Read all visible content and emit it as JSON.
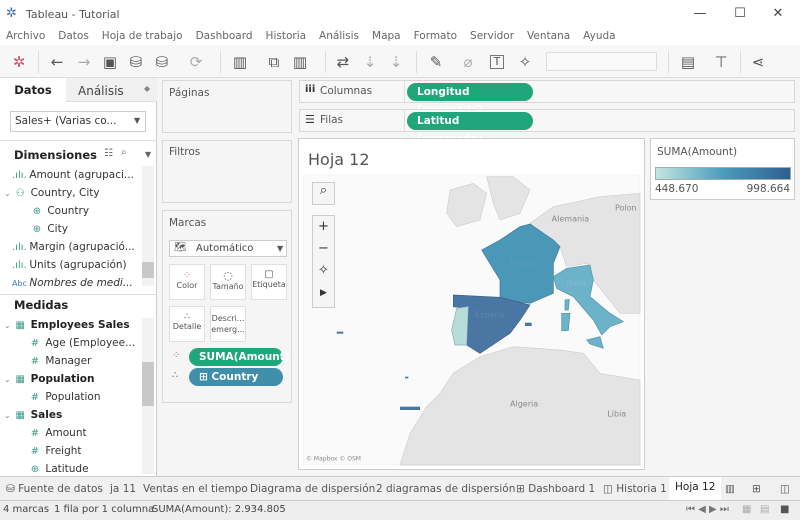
{
  "window": {
    "title": "Tableau - Tutorial",
    "minimize": "—",
    "maximize": "☐",
    "close": "✕"
  },
  "menu": [
    "Archivo",
    "Datos",
    "Hoja de trabajo",
    "Dashboard",
    "Historia",
    "Análisis",
    "Mapa",
    "Formato",
    "Servidor",
    "Ventana",
    "Ayuda"
  ],
  "left": {
    "tab_data": "Datos",
    "tab_analysis": "Análisis",
    "datasource": "Sales+ (Varias co...",
    "dimensions_label": "Dimensiones",
    "dimensions": [
      {
        "icon": "bin",
        "label": "Amount (agrupaci..."
      },
      {
        "icon": "hierarchy",
        "label": "Country, City"
      },
      {
        "icon": "globe",
        "label": "Country"
      },
      {
        "icon": "globe",
        "label": "City"
      },
      {
        "icon": "bin",
        "label": "Margin (agrupació..."
      },
      {
        "icon": "bin",
        "label": "Units (agrupación)"
      },
      {
        "icon": "abc",
        "label": "Nombres de medi..."
      }
    ],
    "measures_label": "Medidas",
    "measures": [
      {
        "type": "table",
        "label": "Employees Sales"
      },
      {
        "type": "num",
        "label": "Age (Employee..."
      },
      {
        "type": "num",
        "label": "Manager"
      },
      {
        "type": "table",
        "label": "Population"
      },
      {
        "type": "num",
        "label": "Population"
      },
      {
        "type": "table",
        "label": "Sales"
      },
      {
        "type": "num",
        "label": "Amount"
      },
      {
        "type": "num",
        "label": "Freight"
      },
      {
        "type": "globe",
        "label": "Latitude"
      }
    ]
  },
  "cards": {
    "pages": "Páginas",
    "filters": "Filtros",
    "marks": "Marcas",
    "mark_type": "Automático",
    "color": "Color",
    "size": "Tamaño",
    "label": "Etiqueta",
    "detail": "Detalle",
    "tooltip": "Descri... emerg...",
    "pill_color": "SUMA(Amount)",
    "pill_detail": "Country"
  },
  "shelves": {
    "columns_label": "Columnas",
    "columns_pill": "Longitud (generado)",
    "rows_label": "Filas",
    "rows_pill": "Latitud (generado)"
  },
  "view": {
    "title": "Hoja 12",
    "attribution": "© Mapbox © OSM",
    "map_labels": {
      "germany": "Alemania",
      "poland": "Polon",
      "france": "Francia",
      "spain": "España",
      "italy": "Italia",
      "algeria": "Algeria",
      "libya": "Libia"
    },
    "regions": [
      {
        "country": "Spain",
        "color": "#4a76a4"
      },
      {
        "country": "France",
        "color": "#4b97b8"
      },
      {
        "country": "Italy",
        "color": "#6cb2c9"
      },
      {
        "country": "Portugal",
        "color": "#b7ddd8"
      }
    ]
  },
  "legend": {
    "title": "SUMA(Amount)",
    "min": "448.670",
    "max": "998.664",
    "color_low": "#c4e6e0",
    "color_high": "#2e5f8f"
  },
  "sheet_tabs": [
    "Fuente de datos",
    "ja 11",
    "Ventas en el tiempo",
    "Diagrama de dispersión",
    "2 diagramas de dispersión",
    "Dashboard 1",
    "Historia 1",
    "Hoja 12"
  ],
  "active_tab": "Hoja 12",
  "status": {
    "marks": "4 marcas",
    "rows": "1 fila por 1 columna",
    "sum": "SUMA(Amount): 2.934.805"
  }
}
